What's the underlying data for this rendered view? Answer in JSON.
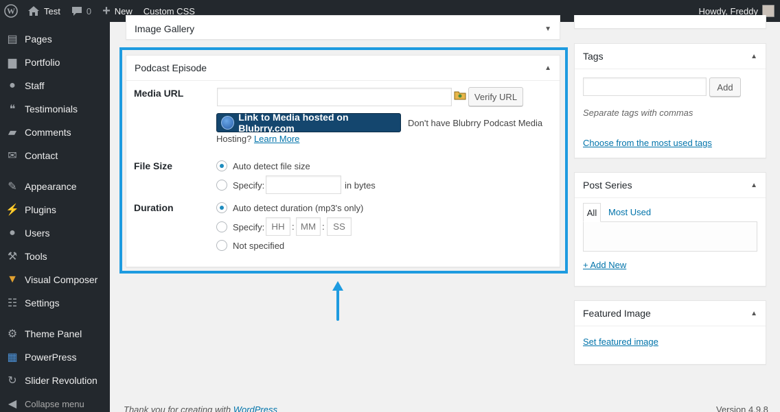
{
  "adminbar": {
    "site_name": "Test",
    "comments_count": "0",
    "new_label": "New",
    "custom_css_label": "Custom CSS",
    "howdy": "Howdy, Freddy"
  },
  "sidebar": {
    "items": [
      {
        "label": "Pages",
        "icon": "pages-icon"
      },
      {
        "label": "Portfolio",
        "icon": "portfolio-icon"
      },
      {
        "label": "Staff",
        "icon": "staff-icon"
      },
      {
        "label": "Testimonials",
        "icon": "testimonials-icon"
      },
      {
        "label": "Comments",
        "icon": "comments-icon"
      },
      {
        "label": "Contact",
        "icon": "contact-icon"
      },
      {
        "label": "Appearance",
        "icon": "appearance-icon"
      },
      {
        "label": "Plugins",
        "icon": "plugins-icon"
      },
      {
        "label": "Users",
        "icon": "users-icon"
      },
      {
        "label": "Tools",
        "icon": "tools-icon"
      },
      {
        "label": "Visual Composer",
        "icon": "visual-composer-icon"
      },
      {
        "label": "Settings",
        "icon": "settings-icon"
      },
      {
        "label": "Theme Panel",
        "icon": "theme-panel-icon"
      },
      {
        "label": "PowerPress",
        "icon": "powerpress-icon"
      },
      {
        "label": "Slider Revolution",
        "icon": "slider-revolution-icon"
      }
    ],
    "collapse_label": "Collapse menu"
  },
  "image_gallery": {
    "title": "Image Gallery"
  },
  "podcast": {
    "title": "Podcast Episode",
    "media_url_label": "Media URL",
    "media_url_value": "",
    "verify_button": "Verify URL",
    "blubrry_button": "Link to Media hosted on Blubrry.com",
    "blubrry_note": "Don't have Blubrry Podcast Media",
    "hosting_prefix": "Hosting?",
    "learn_more": "Learn More",
    "file_size_label": "File Size",
    "auto_detect_size": "Auto detect file size",
    "specify_label": "Specify:",
    "in_bytes": "in bytes",
    "duration_label": "Duration",
    "auto_detect_duration": "Auto detect duration (mp3's only)",
    "hh": "HH",
    "mm": "MM",
    "ss": "SS",
    "colon": ":",
    "not_specified": "Not specified"
  },
  "tags": {
    "title": "Tags",
    "add_button": "Add",
    "hint": "Separate tags with commas",
    "choose_link": "Choose from the most used tags"
  },
  "post_series": {
    "title": "Post Series",
    "tab_all": "All",
    "tab_most_used": "Most Used",
    "add_new": "+ Add New"
  },
  "featured_image": {
    "title": "Featured Image",
    "set_link": "Set featured image"
  },
  "footer": {
    "thanks": "Thank you for creating with",
    "wordpress": "WordPress",
    "version": "Version 4.9.8"
  },
  "colors": {
    "highlight": "#1e9be0",
    "sidebar": "#23282d",
    "link": "#0073aa"
  }
}
